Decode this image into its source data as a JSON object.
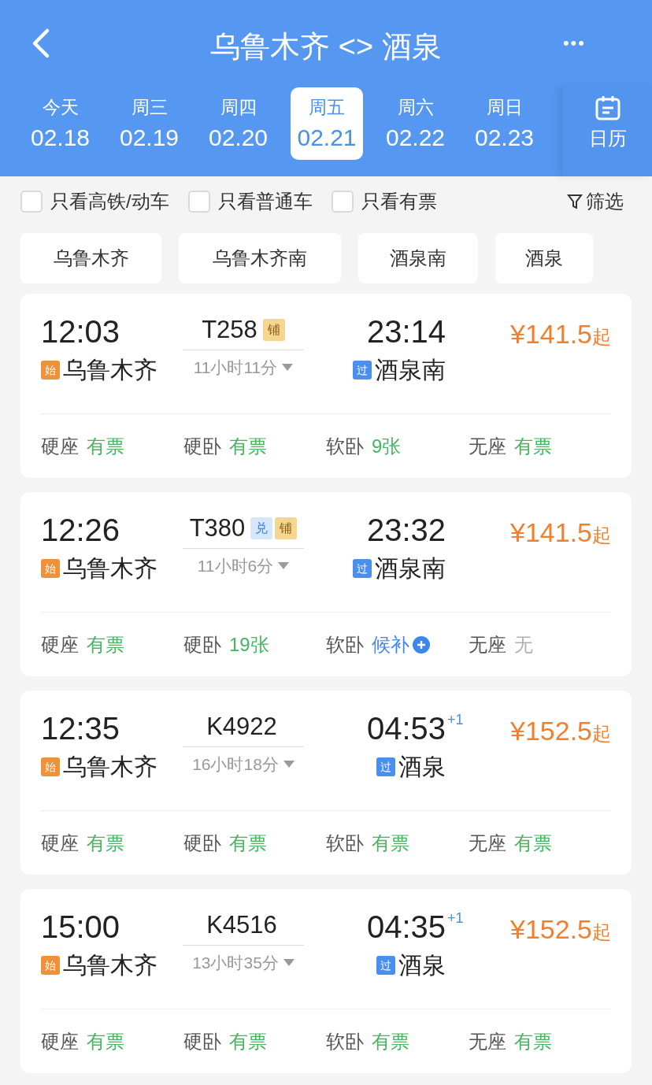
{
  "header": {
    "title": "乌鲁木齐 <> 酒泉",
    "more": "•••"
  },
  "dates": [
    {
      "weekday": "今天",
      "date": "02.18",
      "selected": false
    },
    {
      "weekday": "周三",
      "date": "02.19",
      "selected": false
    },
    {
      "weekday": "周四",
      "date": "02.20",
      "selected": false
    },
    {
      "weekday": "周五",
      "date": "02.21",
      "selected": true
    },
    {
      "weekday": "周六",
      "date": "02.22",
      "selected": false
    },
    {
      "weekday": "周日",
      "date": "02.23",
      "selected": false
    }
  ],
  "calendar": {
    "label": "日历"
  },
  "filters": [
    {
      "label": "只看高铁/动车",
      "checked": false
    },
    {
      "label": "只看普通车",
      "checked": false
    },
    {
      "label": "只看有票",
      "checked": false
    }
  ],
  "filter_button": "筛选",
  "stations": [
    "乌鲁木齐",
    "乌鲁木齐南",
    "酒泉南",
    "酒泉"
  ],
  "trains": [
    {
      "depart": "12:03",
      "number": "T258",
      "tags": [
        {
          "kind": "sleeper",
          "text": "铺"
        }
      ],
      "duration": "11小时11分",
      "arrive": "23:14",
      "price": "¥141.5",
      "price_suffix": "起",
      "from_badge": {
        "kind": "origin",
        "text": "始"
      },
      "from": "乌鲁木齐",
      "to_badge": {
        "kind": "pass",
        "text": "过"
      },
      "to": "酒泉南",
      "seats": [
        {
          "type": "硬座",
          "status": "有票",
          "kind": "available"
        },
        {
          "type": "硬卧",
          "status": "有票",
          "kind": "available"
        },
        {
          "type": "软卧",
          "status": "9张",
          "kind": "available"
        },
        {
          "type": "无座",
          "status": "有票",
          "kind": "available"
        }
      ]
    },
    {
      "depart": "12:26",
      "number": "T380",
      "tags": [
        {
          "kind": "redeem",
          "text": "兑"
        },
        {
          "kind": "sleeper",
          "text": "铺"
        }
      ],
      "duration": "11小时6分",
      "arrive": "23:32",
      "price": "¥141.5",
      "price_suffix": "起",
      "from_badge": {
        "kind": "origin",
        "text": "始"
      },
      "from": "乌鲁木齐",
      "to_badge": {
        "kind": "pass",
        "text": "过"
      },
      "to": "酒泉南",
      "seats": [
        {
          "type": "硬座",
          "status": "有票",
          "kind": "available"
        },
        {
          "type": "硬卧",
          "status": "19张",
          "kind": "available"
        },
        {
          "type": "软卧",
          "status": "候补",
          "kind": "waitlist"
        },
        {
          "type": "无座",
          "status": "无",
          "kind": "none"
        }
      ]
    },
    {
      "depart": "12:35",
      "number": "K4922",
      "duration": "16小时18分",
      "arrive": "04:53",
      "day_offset": "+1",
      "price": "¥152.5",
      "price_suffix": "起",
      "from_badge": {
        "kind": "origin",
        "text": "始"
      },
      "from": "乌鲁木齐",
      "to_badge": {
        "kind": "pass",
        "text": "过"
      },
      "to": "酒泉",
      "seats": [
        {
          "type": "硬座",
          "status": "有票",
          "kind": "available"
        },
        {
          "type": "硬卧",
          "status": "有票",
          "kind": "available"
        },
        {
          "type": "软卧",
          "status": "有票",
          "kind": "available"
        },
        {
          "type": "无座",
          "status": "有票",
          "kind": "available"
        }
      ]
    },
    {
      "depart": "15:00",
      "number": "K4516",
      "duration": "13小时35分",
      "arrive": "04:35",
      "day_offset": "+1",
      "price": "¥152.5",
      "price_suffix": "起",
      "from_badge": {
        "kind": "origin",
        "text": "始"
      },
      "from": "乌鲁木齐",
      "to_badge": {
        "kind": "pass",
        "text": "过"
      },
      "to": "酒泉",
      "seats": [
        {
          "type": "硬座",
          "status": "有票",
          "kind": "available"
        },
        {
          "type": "硬卧",
          "status": "有票",
          "kind": "available"
        },
        {
          "type": "软卧",
          "status": "有票",
          "kind": "available"
        },
        {
          "type": "无座",
          "status": "有票",
          "kind": "available"
        }
      ]
    }
  ]
}
